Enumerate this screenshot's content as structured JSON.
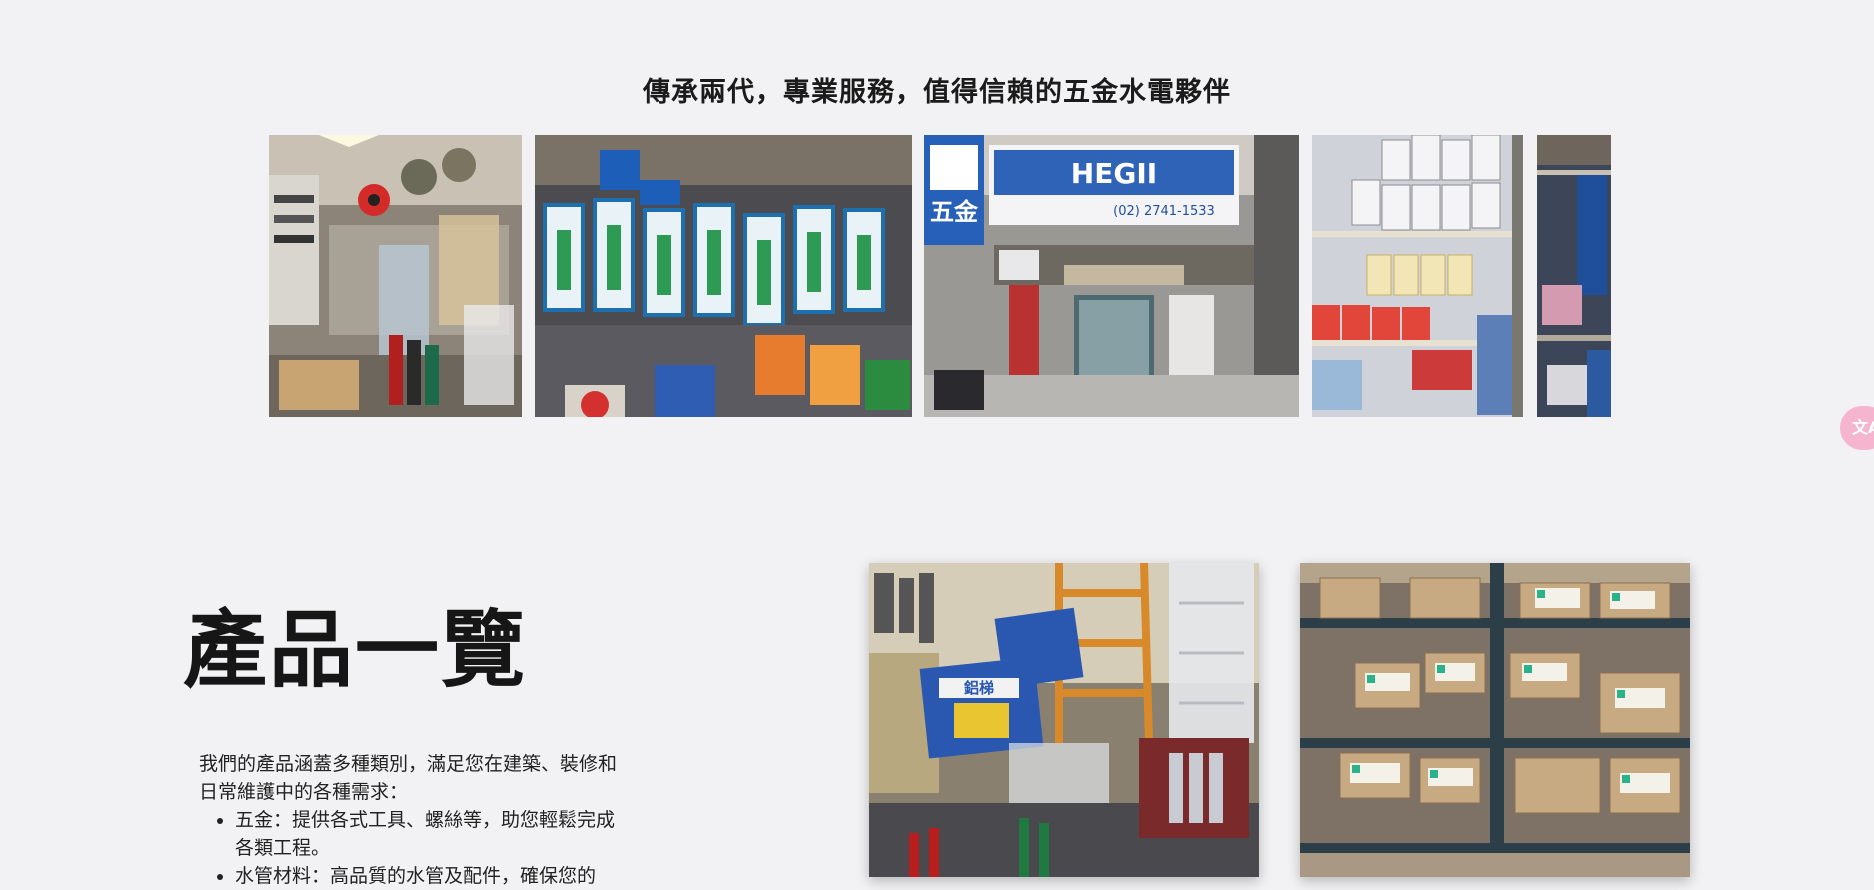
{
  "tagline": "傳承兩代，專業服務，值得信賴的五金水電夥伴",
  "gallery": {
    "photos": [
      {
        "icon": "store-interior-tools-photo"
      },
      {
        "icon": "power-strips-display-photo"
      },
      {
        "icon": "storefront-sign-photo"
      },
      {
        "icon": "light-bulbs-shelf-photo"
      },
      {
        "icon": "cables-shelf-photo"
      }
    ],
    "storefront_sign": "HEGII",
    "storefront_phone": "(02) 2741-1533",
    "side_sign": "五金"
  },
  "translate_badge": "文A",
  "products": {
    "heading": "產品一覽",
    "intro": "我們的產品涵蓋多種類別，滿足您在建築、裝修和日常維護中的各種需求：",
    "items": [
      "五金：提供各式工具、螺絲等，助您輕鬆完成各類工程。",
      "水管材料：高品質的水管及配件，確保您的"
    ],
    "photos": [
      {
        "icon": "ladders-display-photo",
        "label": "鋁梯"
      },
      {
        "icon": "screw-boxes-shelf-photo"
      }
    ]
  },
  "colors": {
    "background": "#f2f2f4",
    "badge": "#f6b5cf",
    "sign_blue": "#1f4fa0"
  }
}
